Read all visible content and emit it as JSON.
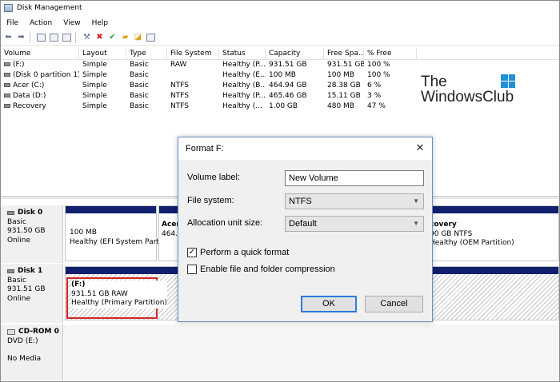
{
  "window": {
    "title": "Disk Management"
  },
  "menu": [
    "File",
    "Action",
    "View",
    "Help"
  ],
  "toolbar": {
    "icons": [
      "back-arrow-icon",
      "forward-arrow-icon",
      "properties-icon",
      "help-icon",
      "show-hide-icon",
      "connect-icon",
      "delete-icon",
      "check-icon",
      "folder-icon",
      "open-icon",
      "more-icon"
    ]
  },
  "volume_list": {
    "columns": [
      "Volume",
      "Layout",
      "Type",
      "File System",
      "Status",
      "Capacity",
      "Free Spa...",
      "% Free"
    ],
    "rows": [
      [
        "(F:)",
        "Simple",
        "Basic",
        "RAW",
        "Healthy (P...",
        "931.51 GB",
        "931.51 GB",
        "100 %"
      ],
      [
        "(Disk 0 partition 1)",
        "Simple",
        "Basic",
        "",
        "Healthy (E...",
        "100 MB",
        "100 MB",
        "100 %"
      ],
      [
        "Acer (C:)",
        "Simple",
        "Basic",
        "NTFS",
        "Healthy (B...",
        "464.94 GB",
        "28.38 GB",
        "6 %"
      ],
      [
        "Data (D:)",
        "Simple",
        "Basic",
        "NTFS",
        "Healthy (P...",
        "465.46 GB",
        "15.11 GB",
        "3 %"
      ],
      [
        "Recovery",
        "Simple",
        "Basic",
        "NTFS",
        "Healthy (...",
        "1.00 GB",
        "480 MB",
        "47 %"
      ]
    ]
  },
  "logo": {
    "line1": "The",
    "line2": "WindowsClub"
  },
  "disks": [
    {
      "name": "Disk 0",
      "type": "Basic",
      "size": "931.50 GB",
      "status": "Online",
      "partitions": [
        {
          "line1": "",
          "line2": "100 MB",
          "line3": "Healthy (EFI System Partiti"
        },
        {
          "line1": "Acer",
          "line2": "464.9",
          "line3": ""
        },
        {
          "line1": "covery",
          "line2": "00 GB NTFS",
          "line3": "Healthy (OEM Partition)"
        }
      ]
    },
    {
      "name": "Disk 1",
      "type": "Basic",
      "size": "931.51 GB",
      "status": "Online",
      "partitions": [
        {
          "line1": "(F:)",
          "line2": "931.51 GB RAW",
          "line3": "Healthy (Primary Partition)"
        }
      ]
    },
    {
      "name": "CD-ROM 0",
      "type": "DVD (E:)",
      "size": "",
      "status": "No Media"
    }
  ],
  "dialog": {
    "title": "Format F:",
    "volume_label": {
      "label": "Volume label:",
      "value": "New Volume"
    },
    "file_system": {
      "label": "File system:",
      "value": "NTFS"
    },
    "allocation": {
      "label": "Allocation unit size:",
      "value": "Default"
    },
    "quick_format": {
      "label": "Perform a quick format",
      "checked": true
    },
    "compression": {
      "label": "Enable file and folder compression",
      "checked": false
    },
    "ok_label": "OK",
    "cancel_label": "Cancel",
    "close_glyph": "✕"
  },
  "colors": {
    "partition_bar": "#10206e",
    "selection": "#d32626",
    "ok_focus": "#2e7bd8"
  }
}
